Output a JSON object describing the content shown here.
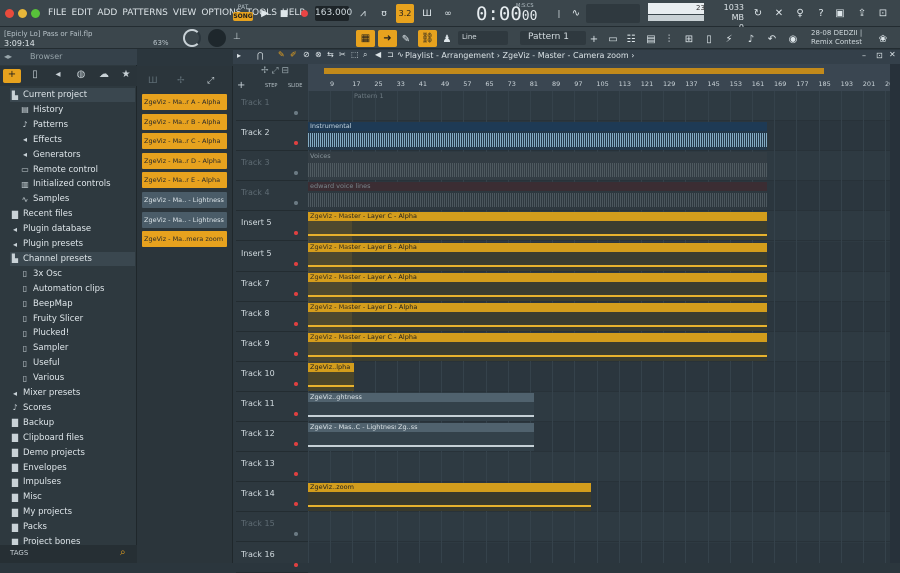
{
  "menu": [
    "FILE",
    "EDIT",
    "ADD",
    "PATTERNS",
    "VIEW",
    "OPTIONS",
    "TOOLS",
    "HELP"
  ],
  "transport": {
    "pat_label": "PAT",
    "song_label": "SONG",
    "tempo": "163.000",
    "time_main": "0:00",
    "time_sub": "00",
    "time_unit": "M:S:CS",
    "step": "3.2"
  },
  "status": {
    "cpu_num": "23",
    "mem": "1033 MB",
    "mem_sub": "0"
  },
  "project": {
    "filename": "[Epicly Lo] Pass or Fail.flp",
    "time": "3:09:14",
    "volume": "63%"
  },
  "toolbar": {
    "snap": "Line",
    "pattern": "Pattern 1"
  },
  "news": {
    "line1": "28-08  DEDZII |",
    "line2": "Remix Contest"
  },
  "browser": {
    "title": "Browser",
    "tags_label": "TAGS",
    "items": [
      {
        "label": "Current project",
        "icon": "folder-open-icon",
        "indent": 0
      },
      {
        "label": "History",
        "icon": "history-icon",
        "indent": 1
      },
      {
        "label": "Patterns",
        "icon": "note-icon",
        "indent": 1
      },
      {
        "label": "Effects",
        "icon": "plug-icon",
        "indent": 1
      },
      {
        "label": "Generators",
        "icon": "plug-icon",
        "indent": 1
      },
      {
        "label": "Remote control",
        "icon": "remote-icon",
        "indent": 1
      },
      {
        "label": "Initialized controls",
        "icon": "sliders-icon",
        "indent": 1
      },
      {
        "label": "Samples",
        "icon": "wave-icon",
        "indent": 1
      },
      {
        "label": "Recent files",
        "icon": "folder-icon",
        "indent": 0
      },
      {
        "label": "Plugin database",
        "icon": "plug-icon",
        "indent": 0
      },
      {
        "label": "Plugin presets",
        "icon": "plug-icon",
        "indent": 0
      },
      {
        "label": "Channel presets",
        "icon": "folder-open-icon",
        "indent": 0
      },
      {
        "label": "3x Osc",
        "icon": "file-icon",
        "indent": 1
      },
      {
        "label": "Automation clips",
        "icon": "file-icon",
        "indent": 1
      },
      {
        "label": "BeepMap",
        "icon": "file-icon",
        "indent": 1
      },
      {
        "label": "Fruity Slicer",
        "icon": "file-icon",
        "indent": 1
      },
      {
        "label": "Plucked!",
        "icon": "file-icon",
        "indent": 1
      },
      {
        "label": "Sampler",
        "icon": "file-icon",
        "indent": 1
      },
      {
        "label": "Useful",
        "icon": "file-icon",
        "indent": 1
      },
      {
        "label": "Various",
        "icon": "file-icon",
        "indent": 1
      },
      {
        "label": "Mixer presets",
        "icon": "plug-icon",
        "indent": 0
      },
      {
        "label": "Scores",
        "icon": "note-icon",
        "indent": 0
      },
      {
        "label": "Backup",
        "icon": "folder-icon",
        "indent": 0
      },
      {
        "label": "Clipboard files",
        "icon": "folder-icon",
        "indent": 0
      },
      {
        "label": "Demo projects",
        "icon": "folder-icon",
        "indent": 0
      },
      {
        "label": "Envelopes",
        "icon": "folder-icon",
        "indent": 0
      },
      {
        "label": "Impulses",
        "icon": "folder-icon",
        "indent": 0
      },
      {
        "label": "Misc",
        "icon": "folder-icon",
        "indent": 0
      },
      {
        "label": "My projects",
        "icon": "folder-icon",
        "indent": 0
      },
      {
        "label": "Packs",
        "icon": "folder-icon",
        "indent": 0
      },
      {
        "label": "Project bones",
        "icon": "folder-icon",
        "indent": 0
      }
    ]
  },
  "clip_list": [
    {
      "label": "ZgeViz - Ma..r A - Alpha",
      "kind": "orange"
    },
    {
      "label": "ZgeViz - Ma..r B - Alpha",
      "kind": "orange"
    },
    {
      "label": "ZgeViz - Ma..r C - Alpha",
      "kind": "orange"
    },
    {
      "label": "ZgeViz - Ma..r D - Alpha",
      "kind": "orange"
    },
    {
      "label": "ZgeViz - Ma..r E - Alpha",
      "kind": "orange"
    },
    {
      "label": "ZgeViz - Ma.. - Lightness",
      "kind": "grey"
    },
    {
      "label": "ZgeViz - Ma.. - Lightness",
      "kind": "grey"
    },
    {
      "label": "ZgeViz - Ma..mera zoom",
      "kind": "orange"
    }
  ],
  "playlist": {
    "title": "Playlist - Arrangement",
    "crumb1": "ZgeViz - Master",
    "crumb2": "Camera zoom",
    "step_label": "STEP",
    "slide_label": "SLIDE",
    "ticks": [
      "9",
      "17",
      "25",
      "33",
      "41",
      "49",
      "57",
      "65",
      "73",
      "81",
      "89",
      "97",
      "105",
      "113",
      "121",
      "129",
      "137",
      "145",
      "153",
      "161",
      "169",
      "177",
      "185",
      "193",
      "201",
      "209"
    ],
    "tracks": [
      {
        "label": "Track 1",
        "dim": true
      },
      {
        "label": "Track 2",
        "dim": false
      },
      {
        "label": "Track 3",
        "dim": true
      },
      {
        "label": "Track 4",
        "dim": true
      },
      {
        "label": "Insert 5",
        "dim": false
      },
      {
        "label": "Insert 5",
        "dim": false
      },
      {
        "label": "Track 7",
        "dim": false
      },
      {
        "label": "Track 8",
        "dim": false
      },
      {
        "label": "Track 9",
        "dim": false
      },
      {
        "label": "Track 10",
        "dim": false
      },
      {
        "label": "Track 11",
        "dim": false
      },
      {
        "label": "Track 12",
        "dim": false
      },
      {
        "label": "Track 13",
        "dim": false
      },
      {
        "label": "Track 14",
        "dim": false
      },
      {
        "label": "Track 15",
        "dim": true
      },
      {
        "label": "Track 16",
        "dim": false
      }
    ],
    "clips": [
      {
        "lane": 0,
        "label": "Pattern 1",
        "kind": "pattern"
      },
      {
        "lane": 1,
        "label": "Instrumental",
        "kind": "audio-blue"
      },
      {
        "lane": 2,
        "label": "Voices",
        "kind": "audio-grey"
      },
      {
        "lane": 3,
        "label": "edward voice lines",
        "kind": "audio-dim"
      },
      {
        "lane": 4,
        "label": "ZgeViz - Master - Layer C - Alpha",
        "kind": "auto"
      },
      {
        "lane": 5,
        "label": "ZgeViz - Master - Layer B - Alpha",
        "kind": "auto"
      },
      {
        "lane": 6,
        "label": "ZgeViz - Master - Layer A - Alpha",
        "kind": "auto"
      },
      {
        "lane": 7,
        "label": "ZgeViz - Master - Layer D - Alpha",
        "kind": "auto"
      },
      {
        "lane": 8,
        "label": "ZgeViz - Master - Layer C - Alpha",
        "kind": "auto"
      },
      {
        "lane": 9,
        "label": "ZgeViz..lpha",
        "kind": "auto-short"
      },
      {
        "lane": 10,
        "label": "ZgeViz..ghtness",
        "kind": "light"
      },
      {
        "lane": 11,
        "label": "ZgeViz - Mas..C - Lightness",
        "kind": "light"
      },
      {
        "lane": 11,
        "label": "Zg..ss",
        "kind": "light"
      },
      {
        "lane": 13,
        "label": "ZgeViz..zoom",
        "kind": "zoom"
      }
    ]
  },
  "colors": {
    "accent": "#e7a21e",
    "blue_clip": "#8fb8d0",
    "clip_orange": "#d39d1c"
  }
}
